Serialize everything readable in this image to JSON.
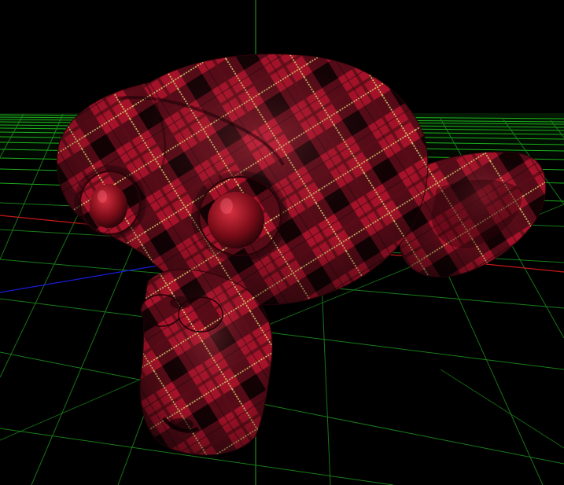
{
  "viewport": {
    "background_color": "#000000",
    "grid_color": "#1c8a1c",
    "grid_far_color": "#22ff22",
    "x_axis_color": "#c81818",
    "y_axis_color": "#1c8a1c",
    "z_axis_color": "#1a1ad8"
  },
  "model": {
    "name_icon": "suzanne-monkey-mesh",
    "material": "red-tartan-plaid",
    "base_color": "#a8122a",
    "highlight_color": "#e03848",
    "dark_stripe_color": "#1a0608",
    "accent_stripe_color": "#d8d070"
  }
}
